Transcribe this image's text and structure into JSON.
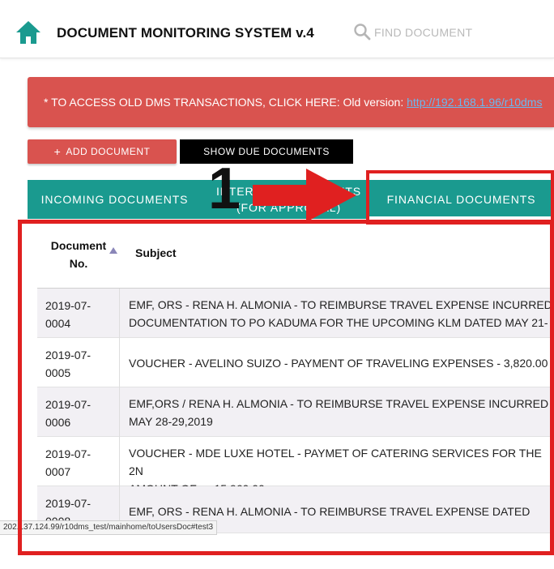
{
  "header": {
    "title": "DOCUMENT MONITORING SYSTEM v.4",
    "search_placeholder": "FIND DOCUMENT"
  },
  "banner": {
    "text": "* TO ACCESS OLD DMS TRANSACTIONS, CLICK HERE: Old version: ",
    "link_text": "http://192.168.1.96/r10dms"
  },
  "actions": {
    "add_label": "ADD DOCUMENT",
    "due_label": "SHOW DUE DOCUMENTS"
  },
  "tabs": [
    {
      "label": "INCOMING DOCUMENTS"
    },
    {
      "label": "INTERNAL DOCUMENTS\n(FOR APPROVAL)"
    },
    {
      "label": "FINANCIAL DOCUMENTS"
    }
  ],
  "annotation": {
    "step_number": "1"
  },
  "table": {
    "columns": [
      "Document\nNo.",
      "Subject"
    ],
    "rows": [
      {
        "doc_no": "2019-07-\n0004",
        "subject": "EMF, ORS - RENA H. ALMONIA - TO REIMBURSE TRAVEL EXPENSE INCURRED\nDOCUMENTATION TO PO KADUMA FOR THE UPCOMING KLM DATED MAY 21-"
      },
      {
        "doc_no": "2019-07-\n0005",
        "subject": "VOUCHER - AVELINO SUIZO - PAYMENT OF TRAVELING EXPENSES - 3,820.00"
      },
      {
        "doc_no": "2019-07-\n0006",
        "subject": "EMF,ORS / RENA H. ALMONIA - TO REIMBURSE TRAVEL EXPENSE INCURRED\nMAY 28-29,2019"
      },
      {
        "doc_no": "2019-07-\n0007",
        "subject": "VOUCHER - MDE LUXE HOTEL - PAYMET OF CATERING SERVICES FOR THE 2N\nAMOUNT OF — 15,960.00"
      },
      {
        "doc_no": "2019-07-\n0008",
        "subject": "EMF, ORS - RENA H. ALMONIA - TO REIMBURSE TRAVEL EXPENSE DATED JUN"
      }
    ]
  },
  "statusbar": {
    "url": "202.137.124.99/r10dms_test/mainhome/toUsersDoc#test3"
  },
  "colors": {
    "teal": "#1a9a8f",
    "danger": "#d9534f",
    "annotation_red": "#e02020"
  }
}
